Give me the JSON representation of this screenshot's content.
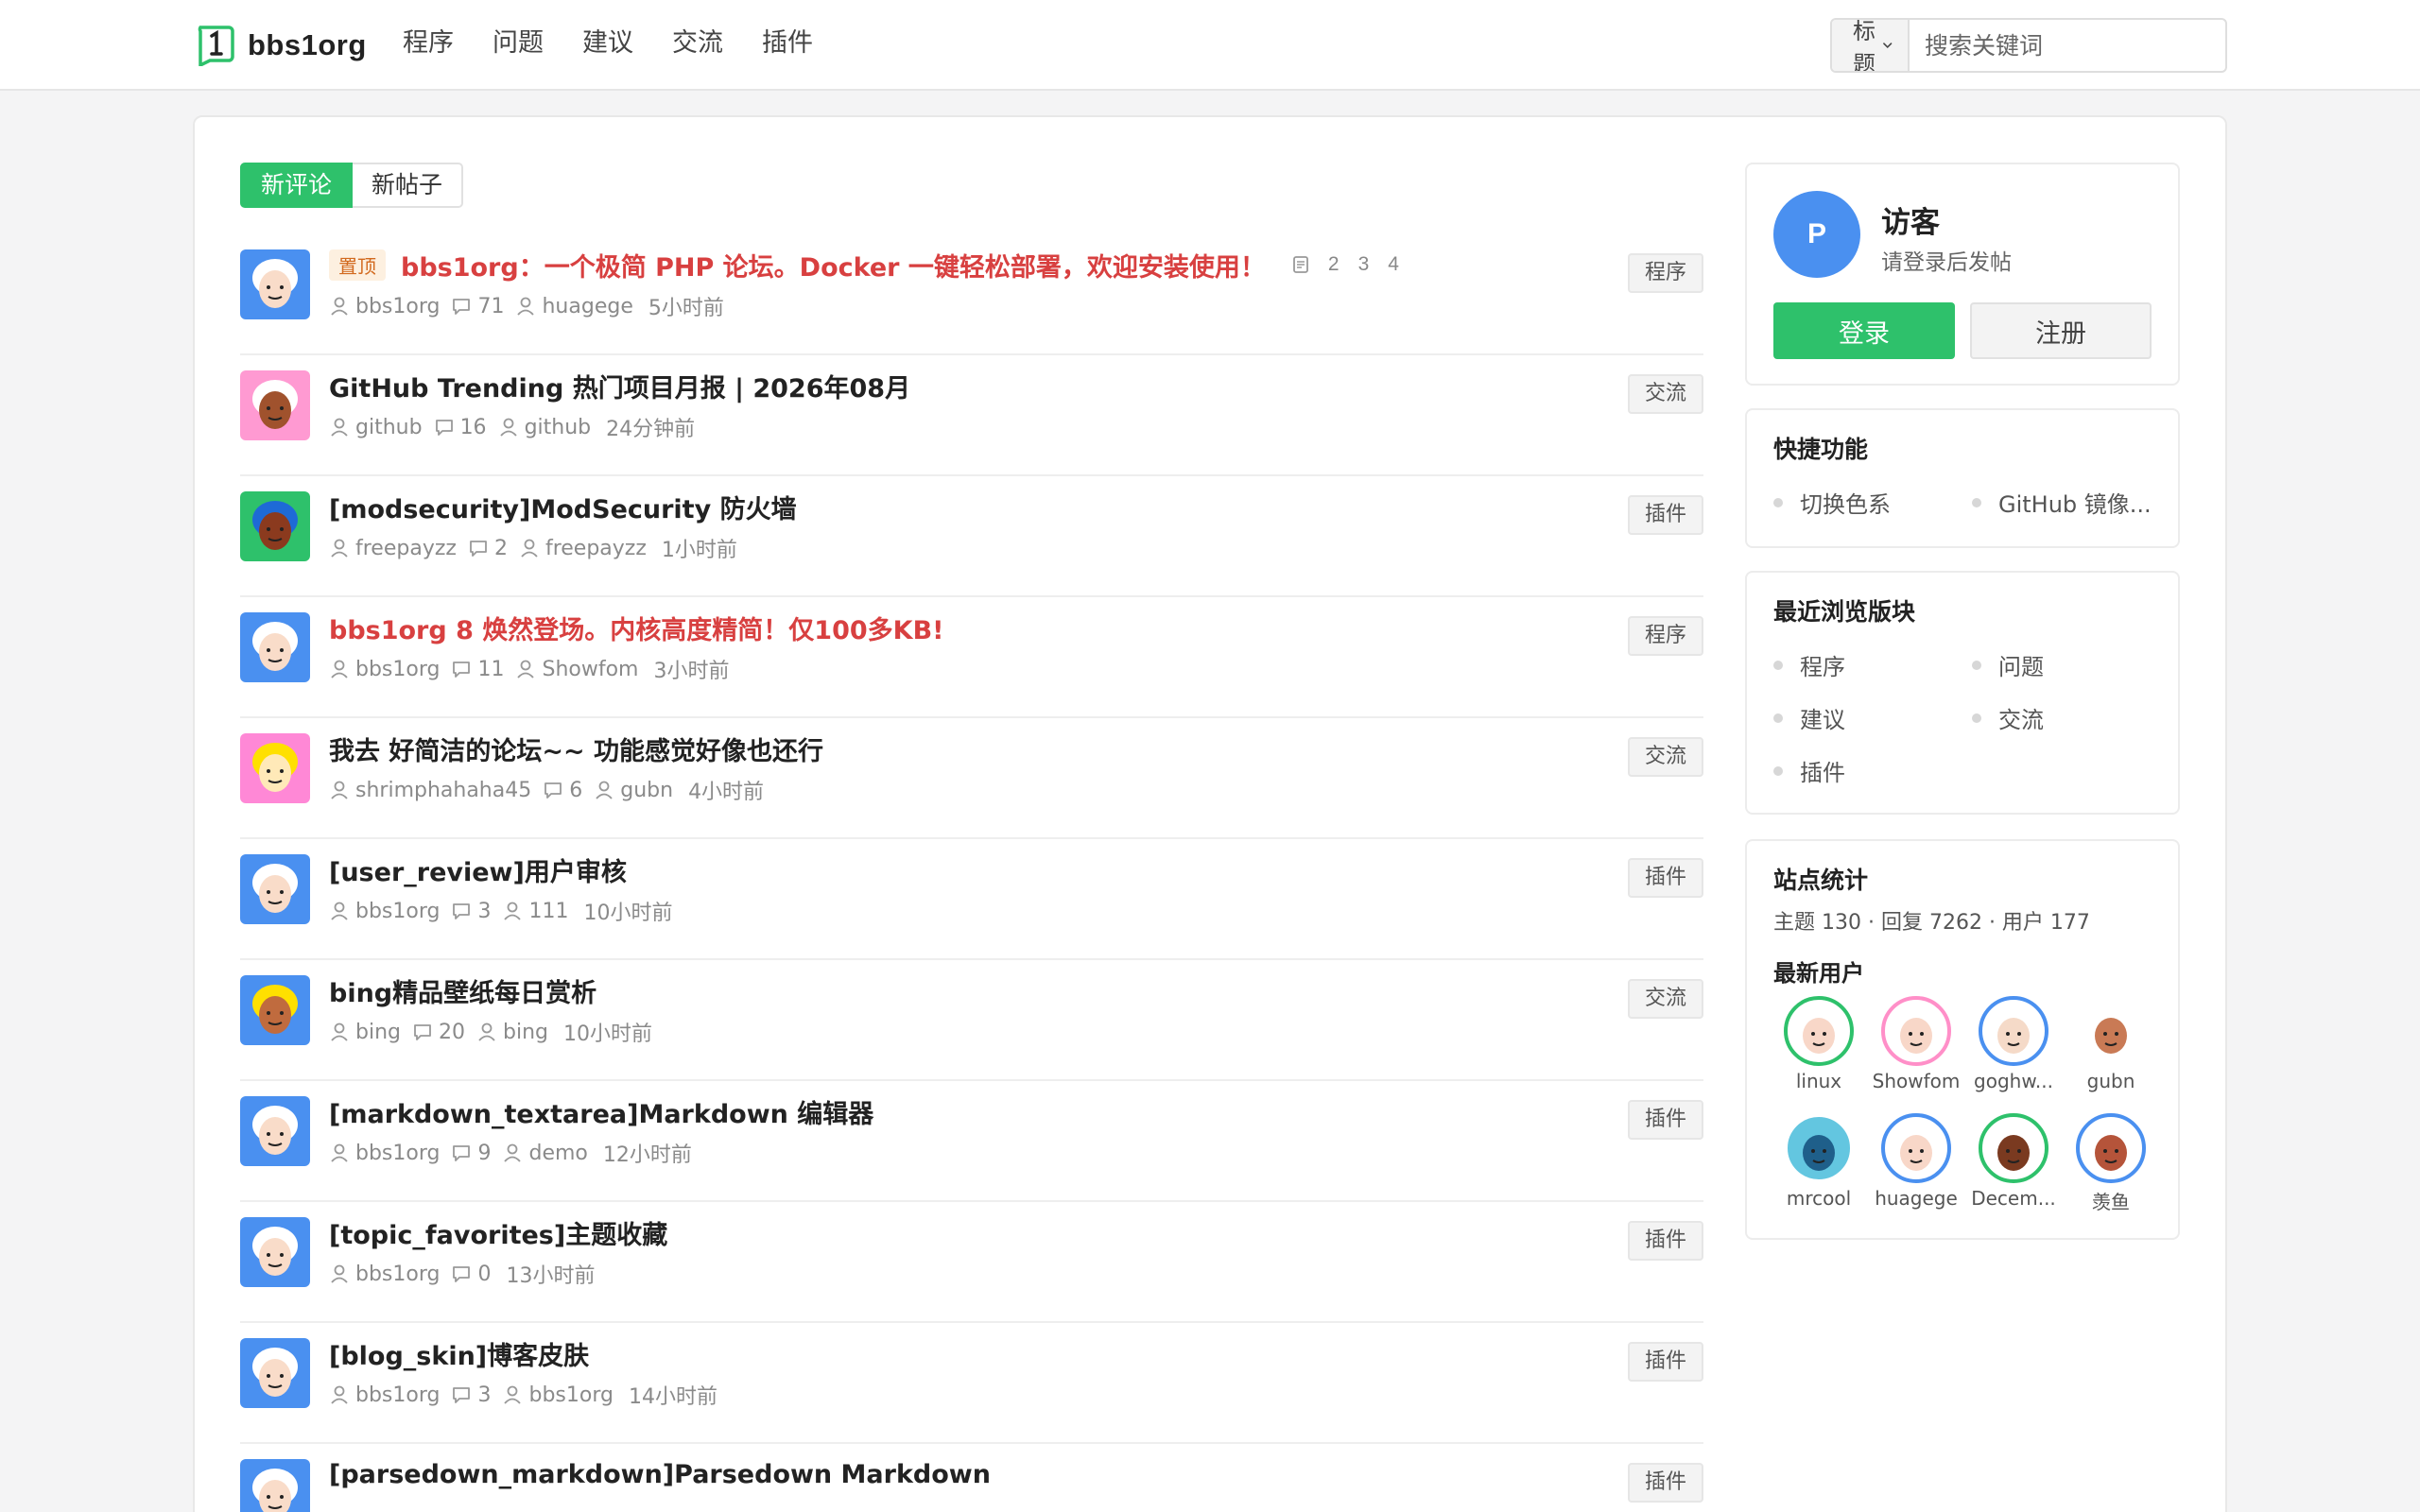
{
  "header": {
    "logo_text": "bbs1org",
    "nav": [
      "程序",
      "问题",
      "建议",
      "交流",
      "插件"
    ],
    "search": {
      "select_value": "标题",
      "placeholder": "搜索关键词"
    }
  },
  "tabs": {
    "active": "新评论",
    "inactive": "新帖子"
  },
  "topics": [
    {
      "pinned": true,
      "badge": "置顶",
      "title": "bbs1org：一个极简 PHP 论坛。Docker 一键轻松部署，欢迎安装使用！",
      "red": true,
      "pages": [
        "2",
        "3",
        "4"
      ],
      "author": "bbs1org",
      "replies": "71",
      "last_user": "huagege",
      "time": "5小时前",
      "tag": "程序",
      "avatar": "white"
    },
    {
      "title": "GitHub Trending 热门项目月报 | 2026年08月",
      "author": "github",
      "replies": "16",
      "last_user": "github",
      "time": "24分钟前",
      "tag": "交流",
      "avatar": "pink"
    },
    {
      "title": "[modsecurity]ModSecurity 防火墙",
      "author": "freepayzz",
      "replies": "2",
      "last_user": "freepayzz",
      "time": "1小时前",
      "tag": "插件",
      "avatar": "green"
    },
    {
      "title": "bbs1org 8 焕然登场。内核高度精简！仅100多KB!",
      "red": true,
      "author": "bbs1org",
      "replies": "11",
      "last_user": "Showfom",
      "time": "3小时前",
      "tag": "程序",
      "avatar": "white"
    },
    {
      "title": "我去 好简洁的论坛~~ 功能感觉好像也还行",
      "author": "shrimphahaha45",
      "replies": "6",
      "last_user": "gubn",
      "time": "4小时前",
      "tag": "交流",
      "avatar": "magenta"
    },
    {
      "title": "[user_review]用户审核",
      "author": "bbs1org",
      "replies": "3",
      "last_user": "111",
      "time": "10小时前",
      "tag": "插件",
      "avatar": "white"
    },
    {
      "title": "bing精品壁纸每日赏析",
      "author": "bing",
      "replies": "20",
      "last_user": "bing",
      "time": "10小时前",
      "tag": "交流",
      "avatar": "yellow"
    },
    {
      "title": "[markdown_textarea]Markdown 编辑器",
      "author": "bbs1org",
      "replies": "9",
      "last_user": "demo",
      "time": "12小时前",
      "tag": "插件",
      "avatar": "white"
    },
    {
      "title": "[topic_favorites]主题收藏",
      "author": "bbs1org",
      "replies": "0",
      "last_user": "",
      "time": "13小时前",
      "tag": "插件",
      "avatar": "white"
    },
    {
      "title": "[blog_skin]博客皮肤",
      "author": "bbs1org",
      "replies": "3",
      "last_user": "bbs1org",
      "time": "14小时前",
      "tag": "插件",
      "avatar": "white"
    },
    {
      "title": "[parsedown_markdown]Parsedown Markdown",
      "author": "",
      "replies": "",
      "last_user": "",
      "time": "",
      "tag": "插件",
      "avatar": "white"
    }
  ],
  "sidebar": {
    "guest": {
      "avatar_letter": "P",
      "name": "访客",
      "hint": "请登录后发帖",
      "login": "登录",
      "register": "注册"
    },
    "quick": {
      "title": "快捷功能",
      "items": [
        "切换色系",
        "GitHub 镜像..."
      ]
    },
    "recent": {
      "title": "最近浏览版块",
      "items": [
        "程序",
        "问题",
        "建议",
        "交流",
        "插件"
      ]
    },
    "stats": {
      "title": "站点统计",
      "summary": "主题 130 · 回复 7262 · 用户 177",
      "new_users_title": "最新用户",
      "users": [
        {
          "name": "linux",
          "ring": "#2ec16b",
          "bg": "#ffffff",
          "face": "#f8d7c8"
        },
        {
          "name": "Showfom",
          "ring": "#ff8fc8",
          "bg": "#ffffff",
          "face": "#f8d7c8"
        },
        {
          "name": "goghw...",
          "ring": "#4a90f0",
          "bg": "#ffffff",
          "face": "#f5dac8"
        },
        {
          "name": "gubn",
          "ring": "#ffffff",
          "bg": "#ffffff",
          "face": "#c97a55"
        },
        {
          "name": "mrcool",
          "ring": "#ffffff",
          "bg": "#63c6e0",
          "face": "#1f5f8a"
        },
        {
          "name": "huagege",
          "ring": "#4a90f0",
          "bg": "#ffffff",
          "face": "#f8d7c8"
        },
        {
          "name": "Decem...",
          "ring": "#2ec16b",
          "bg": "#ffffff",
          "face": "#7a3a20"
        },
        {
          "name": "羡鱼",
          "ring": "#4a90f0",
          "bg": "#ffffff",
          "face": "#b5543a"
        }
      ]
    }
  },
  "colors": {
    "brand": "#2ec16b",
    "red_title": "#d84040",
    "guest_blue": "#4a90f0"
  }
}
